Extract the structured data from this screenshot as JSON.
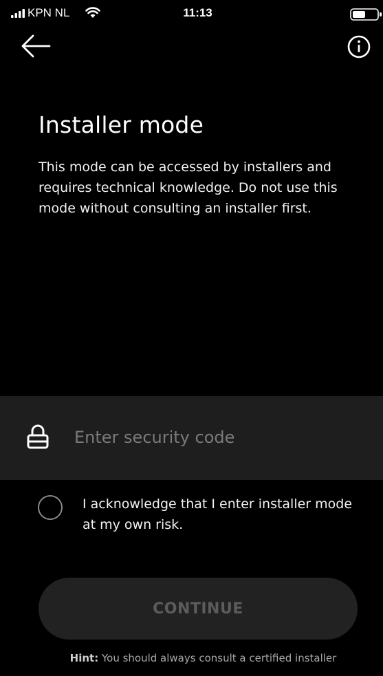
{
  "status_bar": {
    "carrier": "KPN NL",
    "time": "11:13",
    "signal_icon": "cellular-signal-icon",
    "wifi_icon": "wifi-icon",
    "battery_icon": "battery-icon"
  },
  "nav": {
    "back_icon": "arrow-left-icon",
    "info_icon": "info-circle-icon"
  },
  "title": "Installer mode",
  "description": "This mode can be accessed by installers and requires technical knowledge. Do not use this mode without consulting an installer first.",
  "security_code": {
    "icon": "lock-icon",
    "placeholder": "Enter security code",
    "value": ""
  },
  "acknowledge": {
    "checked": false,
    "label": "I acknowledge that I enter installer mode at my own risk."
  },
  "continue_button": {
    "label": "CONTINUE",
    "enabled": false
  },
  "hint": {
    "label": "Hint:",
    "text": " You should always consult a certified installer"
  },
  "colors": {
    "background": "#000000",
    "field_background": "#1e1e1e",
    "button_background": "#222222",
    "button_text_disabled": "#5c5c5c",
    "placeholder_text": "#7a7a7a"
  }
}
